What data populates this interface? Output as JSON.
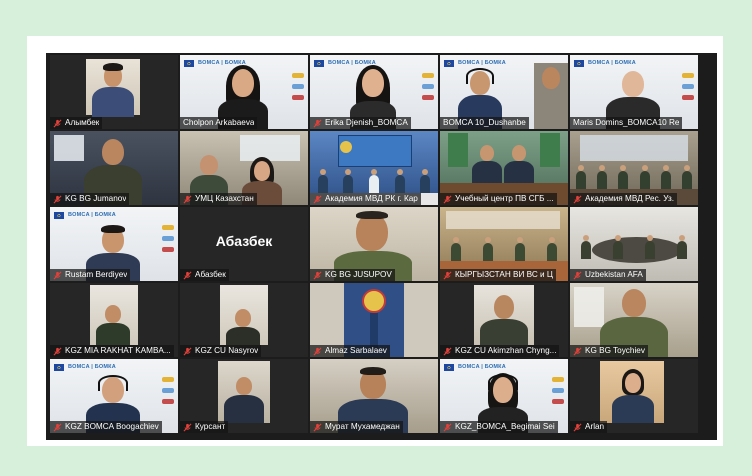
{
  "colors": {
    "page_background": "#d6f0dc",
    "card_background": "#ffffff",
    "grid_background": "#1c1c1c",
    "active_speaker_border": "#b7d94a",
    "muted_mic": "#e2413a"
  },
  "meeting": {
    "tiles": [
      {
        "name": "Алымбек",
        "muted": true
      },
      {
        "name": "Cholpon Arkabaeva",
        "muted": false
      },
      {
        "name": "Erika Djenish_BOMCA",
        "muted": true
      },
      {
        "name": "BOMCA 10_Dushanbe",
        "muted": false,
        "active": true
      },
      {
        "name": "Maris Domins_BOMCA10 Re",
        "muted": false
      },
      {
        "name": "KG BG Jumanov",
        "muted": true
      },
      {
        "name": "УМЦ Казахстан",
        "muted": true
      },
      {
        "name": "Академия МВД РК г. Кар",
        "muted": true
      },
      {
        "name": "Учебный центр ПВ СГБ ...",
        "muted": true
      },
      {
        "name": "Академия МВД Рес. Уз.",
        "muted": true
      },
      {
        "name": "Rustam Berdiyev",
        "muted": true
      },
      {
        "name": "Абазбек",
        "muted": true,
        "video_off": true,
        "display_label": "Абазбек"
      },
      {
        "name": "KG BG JUSUPOV",
        "muted": true
      },
      {
        "name": "КЫРГЫЗСТАН ВИ ВС и Ц",
        "muted": true
      },
      {
        "name": "Uzbekistan AFA",
        "muted": true
      },
      {
        "name": "KGZ MIA RAKHAT KAMBA...",
        "muted": true
      },
      {
        "name": "KGZ CU Nasyrov",
        "muted": true
      },
      {
        "name": "Almaz Sarbalaev",
        "muted": true
      },
      {
        "name": "KGZ CU Akimzhan Chyng...",
        "muted": true
      },
      {
        "name": "KG BG Toychiev",
        "muted": true
      },
      {
        "name": "KGZ BOMCA Boogachiev",
        "muted": true
      },
      {
        "name": "Курсант",
        "muted": true
      },
      {
        "name": "Мурат Мухамеджан",
        "muted": true
      },
      {
        "name": "KGZ_BOMCA_Begimai Sei",
        "muted": true
      },
      {
        "name": "Arlan",
        "muted": true
      }
    ]
  },
  "icons": {
    "muted": "microphone-muted-icon",
    "banner_flag": "eu-flag-icon",
    "banner_logo": "bomca-logo"
  },
  "banner": {
    "logo_text": "BOMCA | БОМКА"
  }
}
